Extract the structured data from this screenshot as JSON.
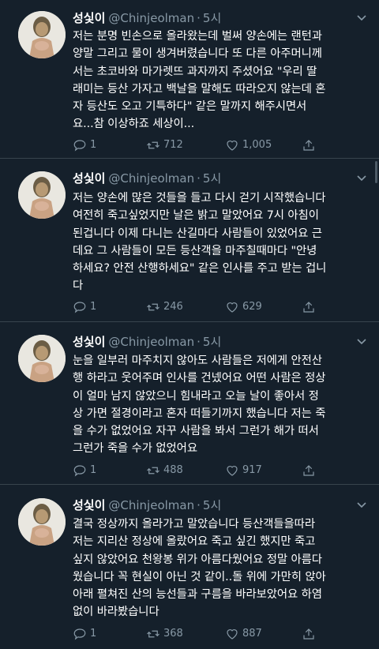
{
  "author": {
    "name": "성싳이",
    "handle": "@Chinjeolman",
    "time": "5시"
  },
  "tweets": [
    {
      "text": "저는 분명 빈손으로 올라왔는데 벌써 양손에는 랜턴과\n양말 그리고 물이 생겨버렸습니다 또 다른 아주머니께\n서는 초코바와 마가렛뜨 과자까지 주셨어요 \"우리 딸\n래미는 등산 가자고 백날을 말해도 따라오지 않는데 혼\n자 등산도 오고 기특하다\" 같은 말까지 해주시면서\n요...참 이상하죠 세상이...",
      "replies": "1",
      "retweets": "712",
      "likes": "1,005"
    },
    {
      "text": "저는 양손에 많은 것들을 들고 다시 걷기 시작했습니다\n여전히 죽고싶었지만 날은 밝고 말았어요 7시 아침이\n된겁니다 이제 다니는 산길마다 사람들이 있었어요 근\n데요 그 사람들이 모든 등산객을 마주칠때마다 \"안녕\n하세요? 안전 산행하세요\" 같은 인사를 주고 받는 겁니\n다",
      "replies": "1",
      "retweets": "246",
      "likes": "629"
    },
    {
      "text": "눈을 일부러 마주치지 않아도 사람들은 저에게 안전산\n행 하라고 웃어주며 인사를 건넸어요 어떤 사람은 정상\n이 얼마 남지 않았으니 힘내라고 오늘 날이 좋아서 정\n상 가면 절경이라고 혼자 떠들기까지 했습니다 저는 죽\n을 수가 없었어요 자꾸 사람을 봐서 그런가 해가 떠서\n그런가 죽을 수가 없었어요",
      "replies": "1",
      "retweets": "488",
      "likes": "917"
    },
    {
      "text": "결국 정상까지 올라가고 말았습니다 등산객들을따라\n저는 지리산 정상에 올랐어요 죽고 싶긴 했지만 죽고\n싶지 않았어요 천왕봉 위가 아름다웠어요 정말 아름다\n웠습니다 꼭 현실이 아닌 것 같이..돌 위에 가만히 앉아\n아래 펼쳐진 산의 능선들과 구름을 바라보았어요 하염\n없이 바라봤습니다",
      "replies": "1",
      "retweets": "368",
      "likes": "887"
    }
  ],
  "icons": {
    "reply": "reply-icon",
    "retweet": "retweet-icon",
    "like": "heart-icon",
    "share": "share-icon",
    "more": "chevron-down-icon"
  },
  "colors": {
    "background": "#15202b",
    "muted": "#8899a6",
    "divider": "#38444d"
  }
}
